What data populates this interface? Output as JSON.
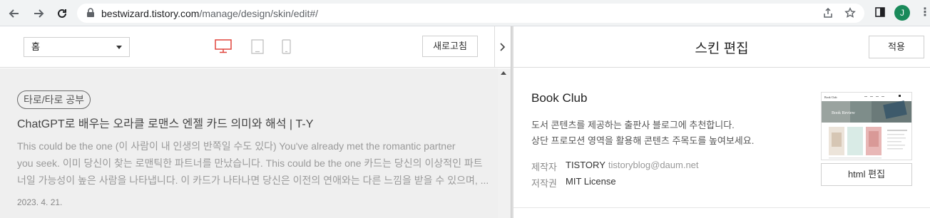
{
  "browser": {
    "url_host": "bestwizard.tistory.com",
    "url_path": "/manage/design/skin/edit#/",
    "avatar_initial": "J",
    "icons": [
      "back-arrow-icon",
      "forward-arrow-icon",
      "reload-icon",
      "lock-icon",
      "share-icon",
      "star-icon",
      "side-panel-icon",
      "kebab-menu-icon"
    ]
  },
  "preview_toolbar": {
    "page_select": "홈",
    "refresh_label": "새로고침",
    "devices": [
      "desktop-icon",
      "tablet-icon",
      "mobile-icon"
    ],
    "active_device_color": "#e0443c"
  },
  "post": {
    "category": "타로/타로 공부",
    "title": "ChatGPT로 배우는 오라클 로맨스 엔젤 카드 의미와 해석 | T-Y",
    "excerpt": [
      "This could be the one (이 사람이 내 인생의 반쪽일 수도 있다) You've already met the romantic partner",
      "you seek. 이미 당신이 찾는 로맨틱한 파트너를 만났습니다. This could be the one 카드는 당신의 이상적인 파트",
      "너일 가능성이 높은 사람을 나타냅니다. 이 카드가 나타나면 당신은 이전의 연애와는 다른 느낌을 받을 수 있으며, ..."
    ],
    "date": "2023. 4. 21."
  },
  "skin_panel": {
    "title": "스킨 편집",
    "apply_label": "적용",
    "skin_name": "Book Club",
    "description": [
      "도서 콘텐츠를 제공하는 출판사 블로그에 추천합니다.",
      "상단 프로모션 영역을 활용해 콘텐츠 주목도를 높여보세요."
    ],
    "maker_label": "제작자",
    "maker_name": "TISTORY",
    "maker_email": "tistoryblog@daum.net",
    "license_label": "저작권",
    "license_value": "MIT License",
    "html_edit_label": "html 편집",
    "thumbnail": {
      "site_name": "Book Club",
      "banner_text": "Book Review"
    }
  }
}
